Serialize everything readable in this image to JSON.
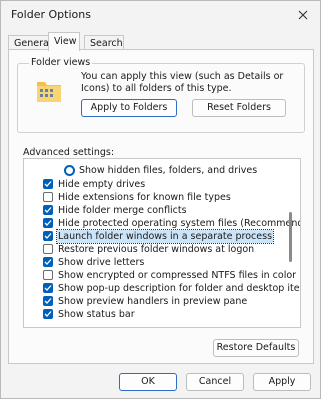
{
  "window": {
    "title": "Folder Options"
  },
  "tabs": [
    {
      "label": "General"
    },
    {
      "label": "View"
    },
    {
      "label": "Search"
    }
  ],
  "folder_views": {
    "group_title": "Folder views",
    "description": "You can apply this view (such as Details or Icons) to all folders of this type.",
    "apply_button": "Apply to Folders",
    "reset_button": "Reset Folders"
  },
  "advanced": {
    "label": "Advanced settings:",
    "items": [
      {
        "label": "Show hidden files, folders, and drives",
        "type": "radio",
        "checked": true
      },
      {
        "label": "Hide empty drives",
        "type": "checkbox",
        "checked": true
      },
      {
        "label": "Hide extensions for known file types",
        "type": "checkbox",
        "checked": false
      },
      {
        "label": "Hide folder merge conflicts",
        "type": "checkbox",
        "checked": true
      },
      {
        "label": "Hide protected operating system files (Recommended)",
        "type": "checkbox",
        "checked": true
      },
      {
        "label": "Launch folder windows in a separate process",
        "type": "checkbox",
        "checked": true,
        "selected": true
      },
      {
        "label": "Restore previous folder windows at logon",
        "type": "checkbox",
        "checked": false
      },
      {
        "label": "Show drive letters",
        "type": "checkbox",
        "checked": true
      },
      {
        "label": "Show encrypted or compressed NTFS files in color",
        "type": "checkbox",
        "checked": false
      },
      {
        "label": "Show pop-up description for folder and desktop items",
        "type": "checkbox",
        "checked": true
      },
      {
        "label": "Show preview handlers in preview pane",
        "type": "checkbox",
        "checked": true
      },
      {
        "label": "Show status bar",
        "type": "checkbox",
        "checked": true
      }
    ]
  },
  "restore_defaults_button": "Restore Defaults",
  "footer": {
    "ok_label": "OK",
    "cancel_label": "Cancel",
    "apply_label": "Apply"
  },
  "colors": {
    "accent": "#005fb8",
    "selection": "#cce4f7"
  }
}
